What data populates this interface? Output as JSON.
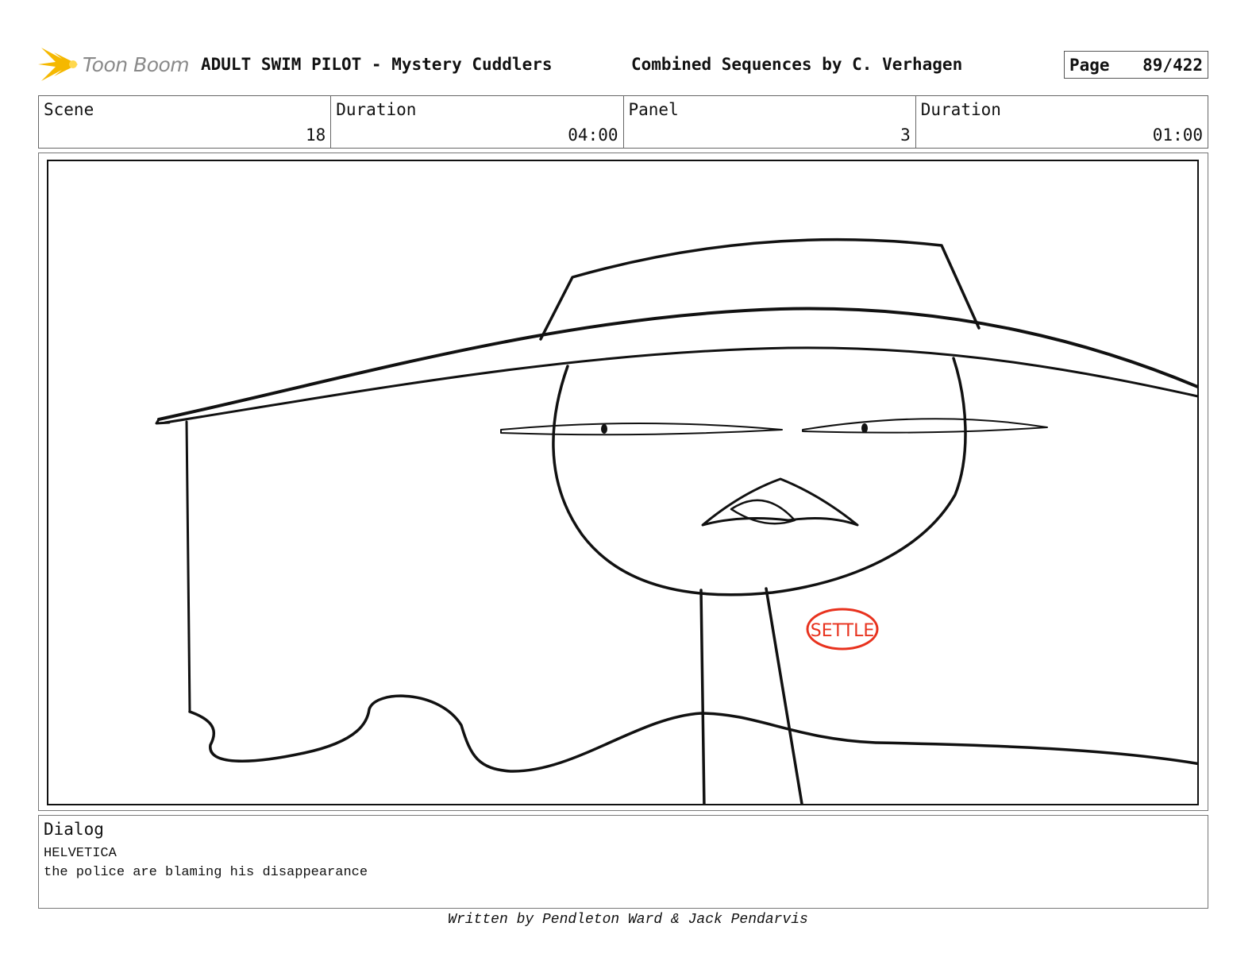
{
  "header": {
    "logo_text": "Toon Boom",
    "title": "ADULT SWIM PILOT - Mystery Cuddlers",
    "subtitle": "Combined Sequences by C. Verhagen",
    "page_label": "Page",
    "page_value": "89/422"
  },
  "info": {
    "scene_label": "Scene",
    "scene_value": "18",
    "scene_duration_label": "Duration",
    "scene_duration_value": "04:00",
    "panel_label": "Panel",
    "panel_value": "3",
    "panel_duration_label": "Duration",
    "panel_duration_value": "01:00"
  },
  "drawing": {
    "badge_text": "SETTLE",
    "stroke_color": "#111111",
    "badge_color": "#e8321e"
  },
  "dialog": {
    "label": "Dialog",
    "speaker": "HELVETICA",
    "line": "the police are blaming his disappearance"
  },
  "footer": {
    "credit": "Written by Pendleton Ward & Jack Pendarvis"
  },
  "colors": {
    "logo_yellow": "#f5b800",
    "logo_text": "#8a8a8a"
  }
}
